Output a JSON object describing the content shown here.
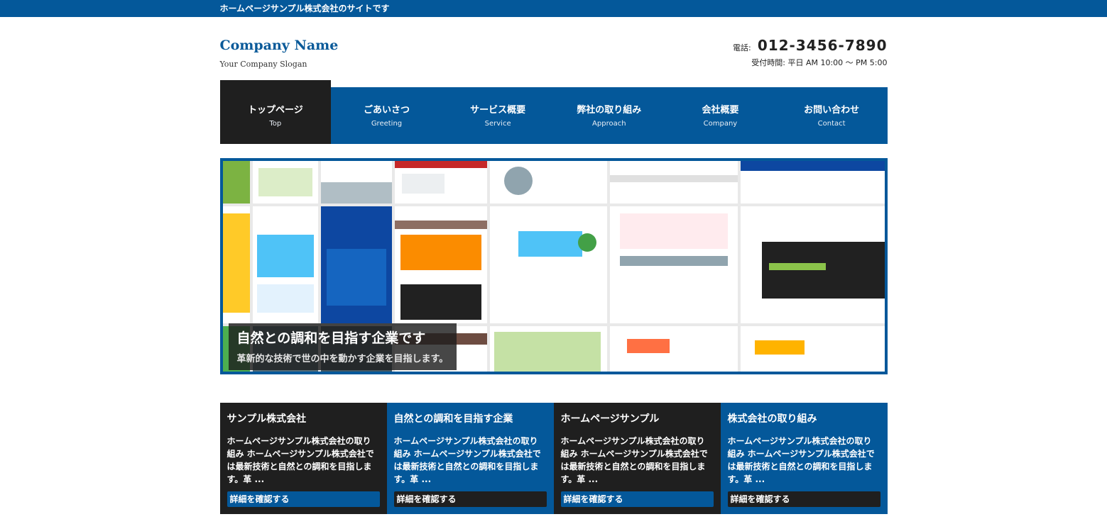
{
  "topbar": {
    "text": "ホームページサンプル株式会社のサイトです"
  },
  "header": {
    "company_name": "Company Name",
    "slogan": "Your Company Slogan",
    "tel_label": "電話:",
    "tel_number": "012-3456-7890",
    "hours": "受付時間: 平日 AM 10:00 〜 PM 5:00"
  },
  "nav": {
    "items": [
      {
        "jp": "トップページ",
        "en": "Top"
      },
      {
        "jp": "ごあいさつ",
        "en": "Greeting"
      },
      {
        "jp": "サービス概要",
        "en": "Service"
      },
      {
        "jp": "弊社の取り組み",
        "en": "Approach"
      },
      {
        "jp": "会社概要",
        "en": "Company"
      },
      {
        "jp": "お問い合わせ",
        "en": "Contact"
      }
    ]
  },
  "hero": {
    "title": "自然との調和を目指す企業です",
    "subtitle": "革新的な技術で世の中を動かす企業を目指します。"
  },
  "cards": [
    {
      "title": "サンプル株式会社",
      "text": "ホームページサンプル株式会社の取り組み ホームページサンプル株式会社では最新技術と自然との調和を目指します。革 ...",
      "more": "詳細を確認する"
    },
    {
      "title": "自然との調和を目指す企業",
      "text": "ホームページサンプル株式会社の取り組み ホームページサンプル株式会社では最新技術と自然との調和を目指します。革 ...",
      "more": "詳細を確認する"
    },
    {
      "title": "ホームページサンプル",
      "text": "ホームページサンプル株式会社の取り組み ホームページサンプル株式会社では最新技術と自然との調和を目指します。革 ...",
      "more": "詳細を確認する"
    },
    {
      "title": "株式会社の取り組み",
      "text": "ホームページサンプル株式会社の取り組み ホームページサンプル株式会社では最新技術と自然との調和を目指します。革 ...",
      "more": "詳細を確認する"
    }
  ],
  "colors": {
    "brand_blue": "#04589a",
    "dark": "#1f1f1f"
  }
}
